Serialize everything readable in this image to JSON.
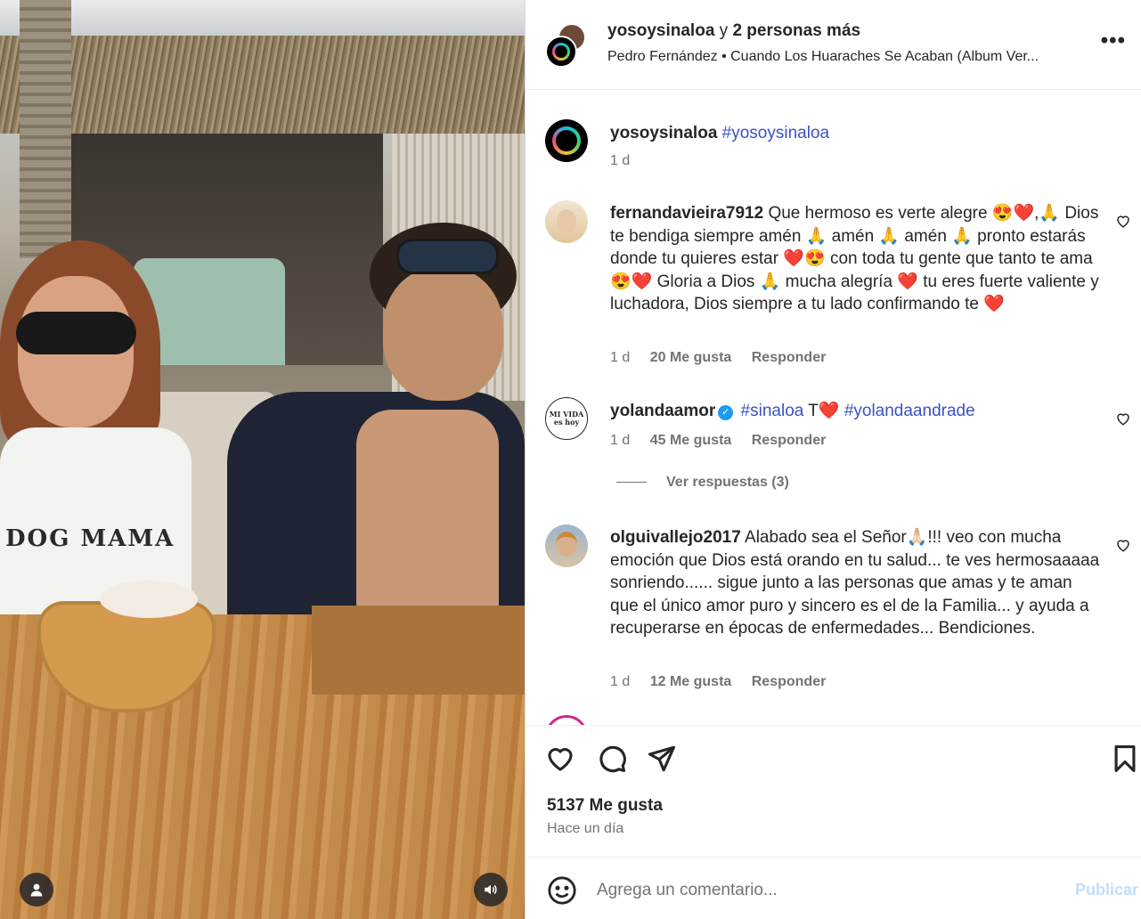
{
  "post": {
    "header": {
      "username": "yosoysinaloa",
      "connector": "y",
      "others": "2 personas más",
      "audio": "Pedro Fernández • Cuando Los Huaraches Se Acaban (Album Ver...",
      "more": "•••"
    },
    "media": {
      "shirt_text": "DOG MAMA"
    }
  },
  "caption": {
    "username": "yosoysinaloa",
    "hashtag": "#yosoysinaloa",
    "time": "1 d"
  },
  "comments": [
    {
      "username": "fernandavieira7912",
      "text": "Que hermoso es verte alegre 😍❤️,🙏 Dios te bendiga siempre amén 🙏 amén 🙏 amén 🙏 pronto estarás donde tu quieres estar ❤️😍 con toda tu gente que tanto te ama 😍❤️ Gloria a Dios 🙏 mucha alegría ❤️ tu eres fuerte valiente y luchadora, Dios siempre a tu lado confirmando te ❤️",
      "time": "1 d",
      "likes": "20 Me gusta",
      "reply": "Responder"
    },
    {
      "username": "yolandaamor",
      "verified_mark": "✓",
      "tag1": "#sinaloa",
      "mid": "T❤️",
      "tag2": "#yolandaandrade",
      "time": "1 d",
      "likes": "45 Me gusta",
      "reply": "Responder",
      "avatar_text": "MI VIDA es hoy",
      "view_replies": "Ver respuestas (3)"
    },
    {
      "username": "olguivallejo2017",
      "text": "Alabado sea el Señor🙏🏻!!! veo con mucha emoción que Dios está orando en tu salud... te ves hermosaaaaa sonriendo...... sigue junto a las personas que amas y te aman que el único amor puro y sincero es el de la Familia... y ayuda a recuperarse en épocas de enfermedades... Bendiciones.",
      "time": "1 d",
      "likes": "12 Me gusta",
      "reply": "Responder"
    }
  ],
  "footer": {
    "likes": "5137 Me gusta",
    "time_ago": "Hace un día",
    "input_placeholder": "Agrega un comentario...",
    "publish": "Publicar"
  },
  "icons": {
    "like": "heart-icon",
    "comment": "comment-bubble-icon",
    "share": "paper-plane-icon",
    "save": "bookmark-icon",
    "emoji": "emoji-smile-icon",
    "tagged_users": "user-icon",
    "audio": "speaker-icon"
  },
  "colors": {
    "hashtag": "#3b52c4",
    "verified": "#1d9bf0",
    "secondary_text": "#737373",
    "publish_disabled": "#c0dffd"
  }
}
